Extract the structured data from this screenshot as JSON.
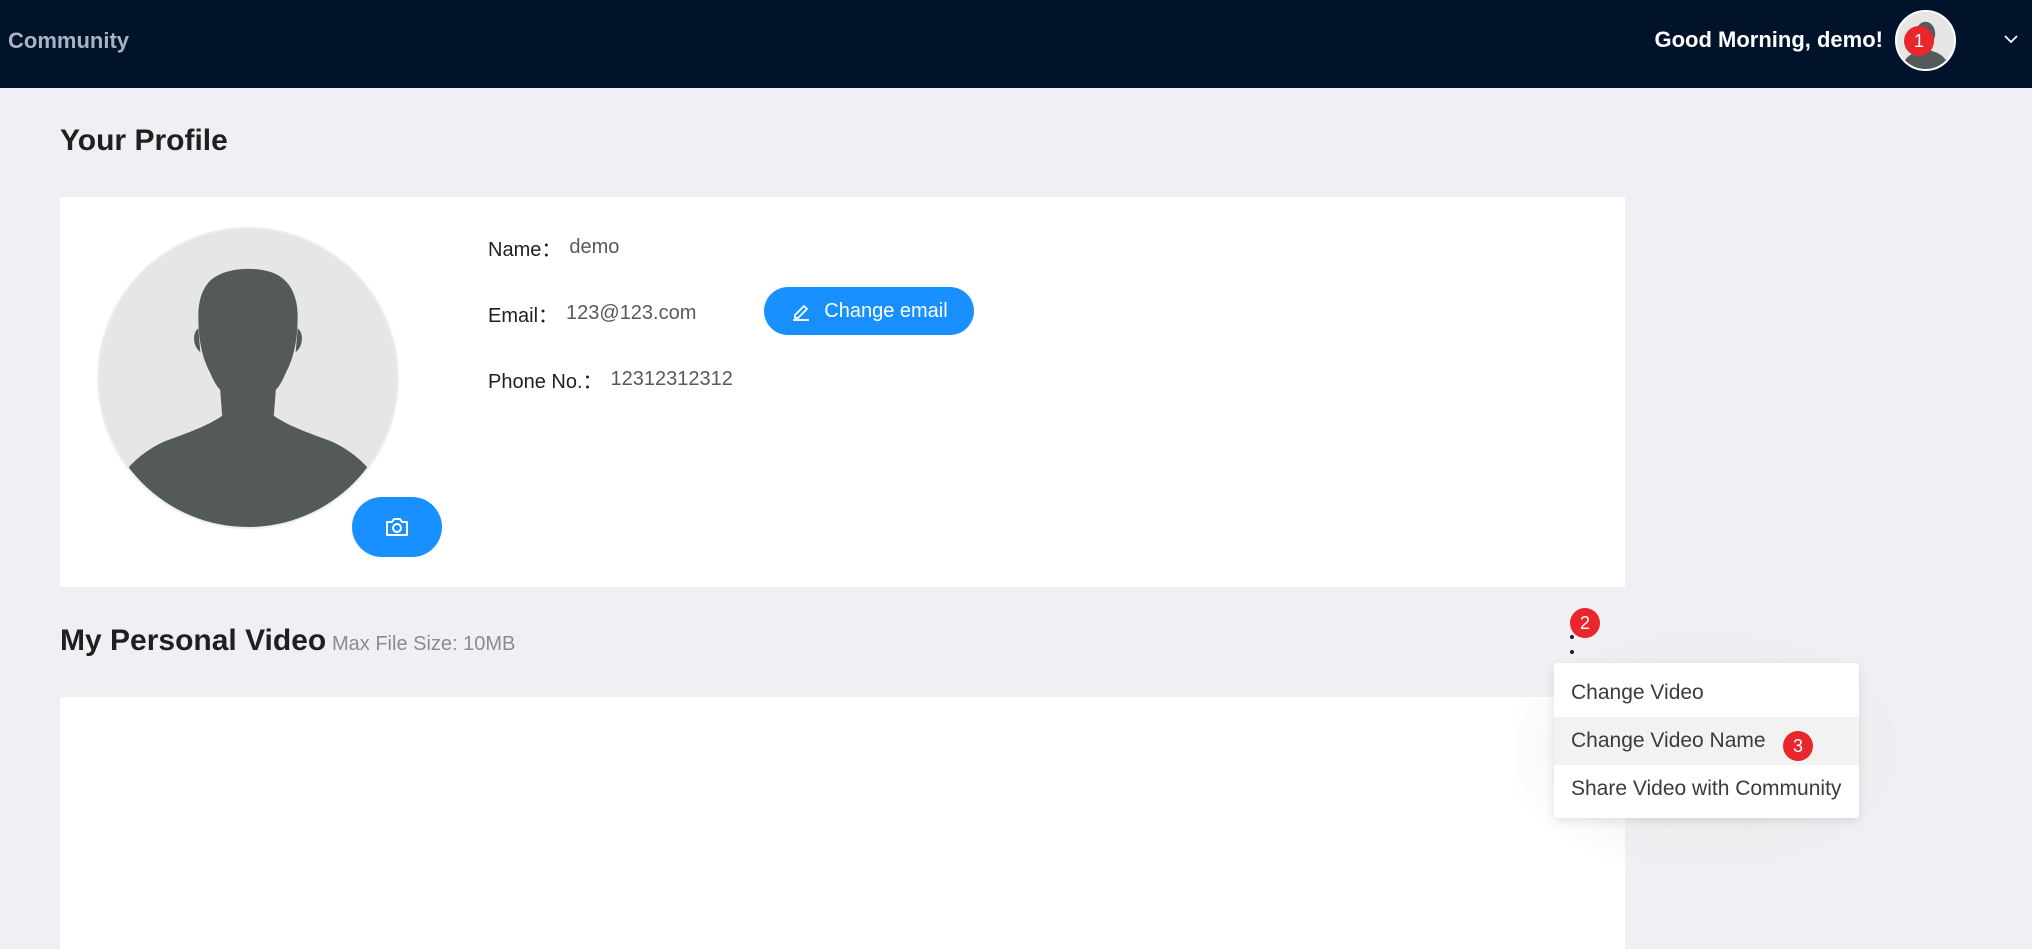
{
  "header": {
    "brand": "Community",
    "greeting": "Good Morning, demo!",
    "badge": "1"
  },
  "profile": {
    "title": "Your Profile",
    "name_label": "Name：",
    "name_value": "demo",
    "email_label": "Email：",
    "email_value": "123@123.com",
    "change_email_label": "Change email",
    "phone_label": "Phone No.：",
    "phone_value": "12312312312"
  },
  "video": {
    "title": "My Personal Video",
    "hint": "Max File Size: 10MB",
    "menu_badge": "2",
    "menu": {
      "items": [
        {
          "label": "Change Video"
        },
        {
          "label": "Change Video Name",
          "badge": "3"
        },
        {
          "label": "Share Video with Community"
        }
      ]
    }
  },
  "colors": {
    "topbar": "#00132a",
    "primary": "#1890ff",
    "badge": "#e8262c",
    "page_bg": "#f0f0f4"
  },
  "icons": {
    "avatar": "person-silhouette-icon",
    "camera": "camera-icon",
    "edit": "edit-icon",
    "more": "more-vertical-icon",
    "dropdown": "chevron-down-icon"
  }
}
